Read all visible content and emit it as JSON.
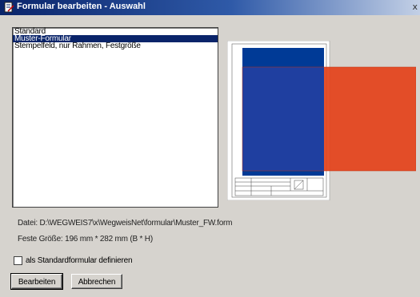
{
  "window": {
    "title": "Formular bearbeiten - Auswahl",
    "close_glyph": "x"
  },
  "form_list": {
    "items": [
      "Standard",
      "Muster-Formular",
      "Stempelfeld, nur Rahmen, Festgröße"
    ],
    "selected_index": 1
  },
  "info": {
    "file": "Datei: D:\\WEGWEIS7\\x\\WegweisNet\\formular\\Muster_FW.form",
    "size": "Feste Größe: 196 mm * 282 mm  (B * H)"
  },
  "checkbox": {
    "label": "als Standardformular definieren",
    "checked": false
  },
  "buttons": {
    "edit": "Bearbeiten",
    "cancel": "Abbrechen"
  },
  "colors": {
    "titlebar_start": "#0a246a",
    "selection": "#0a246a",
    "preview_blue": "#003a96",
    "preview_red": "#e4411a"
  },
  "icons": {
    "window": "form-edit-icon",
    "close": "close-icon"
  }
}
